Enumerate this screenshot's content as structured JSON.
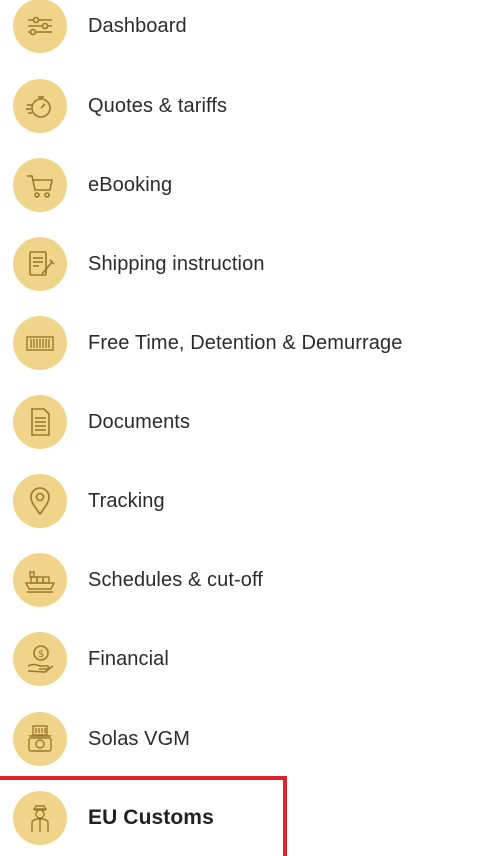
{
  "menu": {
    "items": [
      {
        "label": "Dashboard",
        "icon": "sliders-icon"
      },
      {
        "label": "Quotes & tariffs",
        "icon": "stopwatch-icon"
      },
      {
        "label": "eBooking",
        "icon": "shopping-cart-icon"
      },
      {
        "label": "Shipping instruction",
        "icon": "document-edit-icon"
      },
      {
        "label": "Free Time, Detention & Demurrage",
        "icon": "container-icon"
      },
      {
        "label": "Documents",
        "icon": "document-icon"
      },
      {
        "label": "Tracking",
        "icon": "map-pin-icon"
      },
      {
        "label": "Schedules & cut-off",
        "icon": "ship-icon"
      },
      {
        "label": "Financial",
        "icon": "money-hand-icon"
      },
      {
        "label": "Solas VGM",
        "icon": "weighing-scale-icon"
      },
      {
        "label": "EU Customs",
        "icon": "customs-officer-icon"
      }
    ],
    "active_index": 10
  },
  "colors": {
    "icon_bg": "#f0d48a",
    "icon_stroke": "#9a7a2a",
    "highlight_border": "#e3202a",
    "text": "#2b2b2b"
  }
}
